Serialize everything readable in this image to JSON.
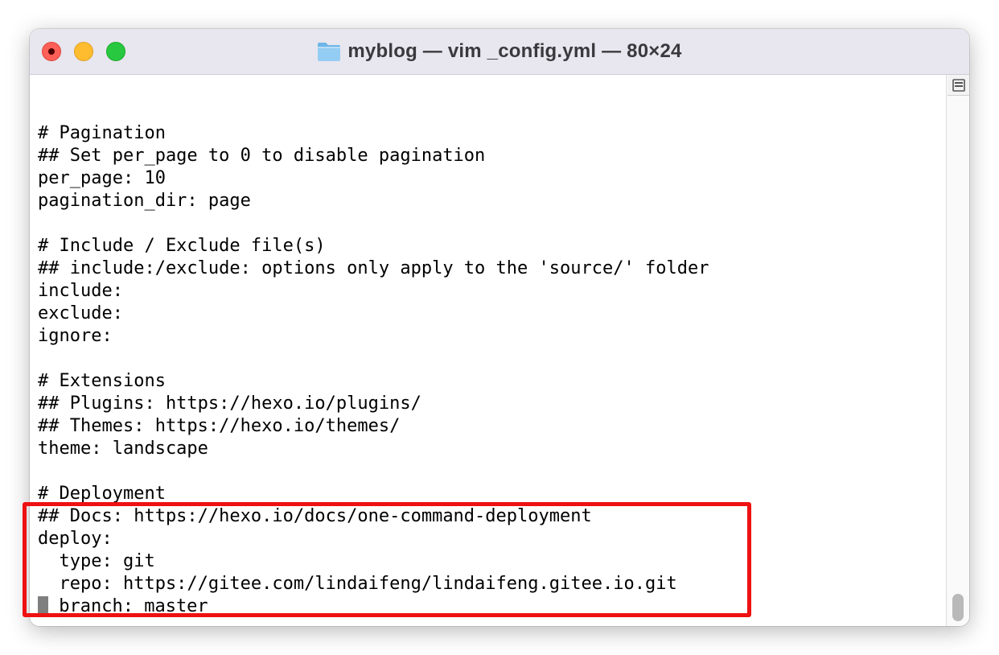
{
  "window": {
    "title": "myblog — vim _config.yml — 80×24",
    "title_icon": "folder-icon"
  },
  "traffic_lights": {
    "close_color": "#fe5f57",
    "minimize_color": "#febc2e",
    "zoom_color": "#28c840"
  },
  "terminal": {
    "lines": [
      "",
      "# Pagination",
      "## Set per_page to 0 to disable pagination",
      "per_page: 10",
      "pagination_dir: page",
      "",
      "# Include / Exclude file(s)",
      "## include:/exclude: options only apply to the 'source/' folder",
      "include:",
      "exclude:",
      "ignore:",
      "",
      "# Extensions",
      "## Plugins: https://hexo.io/plugins/",
      "## Themes: https://hexo.io/themes/",
      "theme: landscape",
      "",
      "# Deployment",
      "## Docs: https://hexo.io/docs/one-command-deployment",
      "deploy:",
      "  type: git",
      "  repo: https://gitee.com/lindaifeng/lindaifeng.gitee.io.git",
      " branch: master"
    ]
  },
  "annotation": {
    "highlight_color": "#ee1111"
  },
  "scrollbar": {
    "split_icon": "split-pane-icon"
  }
}
